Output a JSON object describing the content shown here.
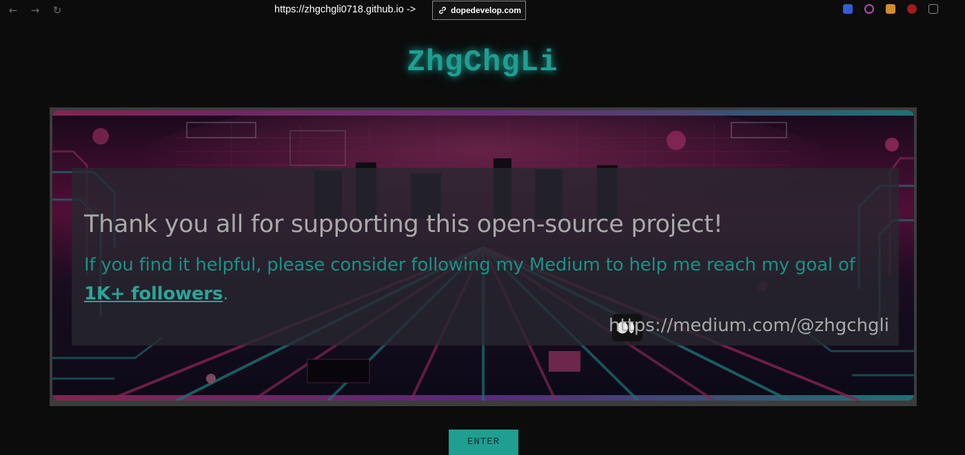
{
  "browser": {
    "url_text": "https://zhgchgli0718.github.io ->",
    "url_pill_text": "dopedevelop.com",
    "nav_icons": [
      "back-arrow-icon",
      "forward-arrow-icon",
      "reload-icon"
    ],
    "extensions": [
      {
        "name": "bitwarden-extension-icon",
        "color": "#2f5fd6"
      },
      {
        "name": "openai-extension-icon",
        "color": "#b64db4"
      },
      {
        "name": "rss-extension-icon",
        "color": "#d58a2a"
      },
      {
        "name": "ublock-extension-icon",
        "color": "#a31a1a"
      },
      {
        "name": "reader-extension-icon",
        "color": "#6a6a6a"
      }
    ]
  },
  "page": {
    "title": "ZhgChgLi",
    "banner": {
      "headline": "Thank you all for supporting this open-source project!",
      "sub_prefix": "If you find it helpful, please consider following my Medium to help me reach my goal of",
      "sub_goal": "1K+ followers",
      "sub_suffix": ".",
      "medium_url": "https://medium.com/@zhgchgli"
    },
    "enter_label": "ENTER"
  },
  "colors": {
    "accent": "#1f9e91",
    "background": "#0c0c0c",
    "neon_pink": "#e0408a",
    "neon_cyan": "#36c3c9"
  }
}
